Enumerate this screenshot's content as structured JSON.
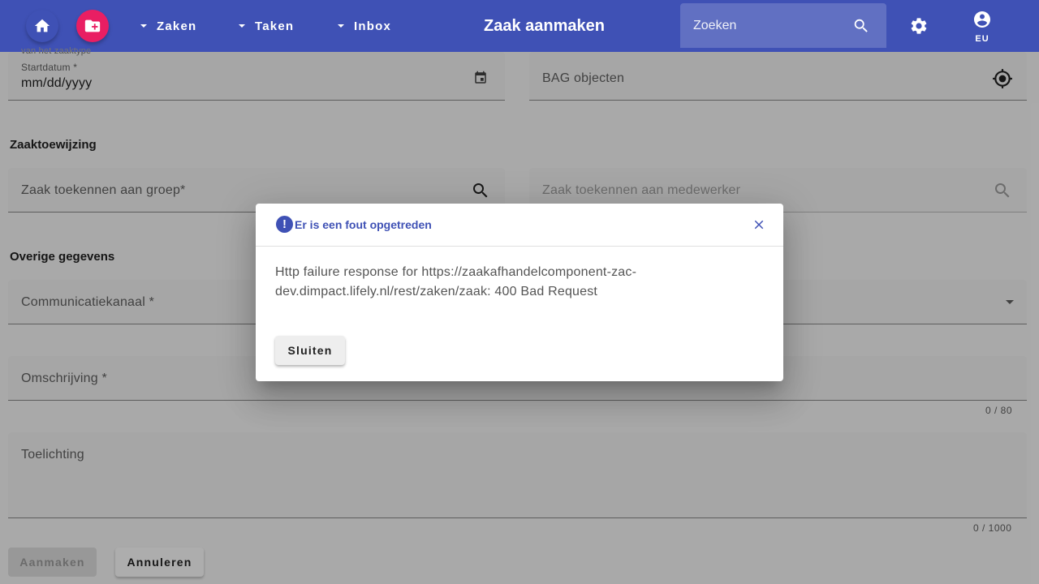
{
  "toolbar": {
    "menus": [
      "Zaken",
      "Taken",
      "Inbox"
    ],
    "title": "Zaak aanmaken",
    "search_placeholder": "Zoeken",
    "account_label": "EU",
    "colors": {
      "primary": "#3f51b5",
      "accent": "#e91e63"
    }
  },
  "form": {
    "clipped_text": "van het zaaktype",
    "startdatum_label": "Startdatum *",
    "startdatum_value": "mm/dd/yyyy",
    "bag_label": "BAG objecten",
    "section_assign": "Zaaktoewijzing",
    "groep_label": "Zaak toekennen aan groep*",
    "medewerker_label": "Zaak toekennen aan medewerker",
    "section_other": "Overige gegevens",
    "communicatiekanaal_label": "Communicatiekanaal *",
    "omschrijving_label": "Omschrijving *",
    "omschrijving_counter": "0 / 80",
    "toelichting_label": "Toelichting",
    "toelichting_counter": "0 / 1000",
    "create_button": "Aanmaken",
    "cancel_button": "Annuleren"
  },
  "dialog": {
    "title": "Er is een fout opgetreden",
    "message_line1": "Http failure response for https://zaakafhandelcomponent-zac-",
    "message_line2": "dev.dimpact.lifely.nl/rest/zaken/zaak: 400 Bad Request",
    "close_button": "Sluiten"
  }
}
